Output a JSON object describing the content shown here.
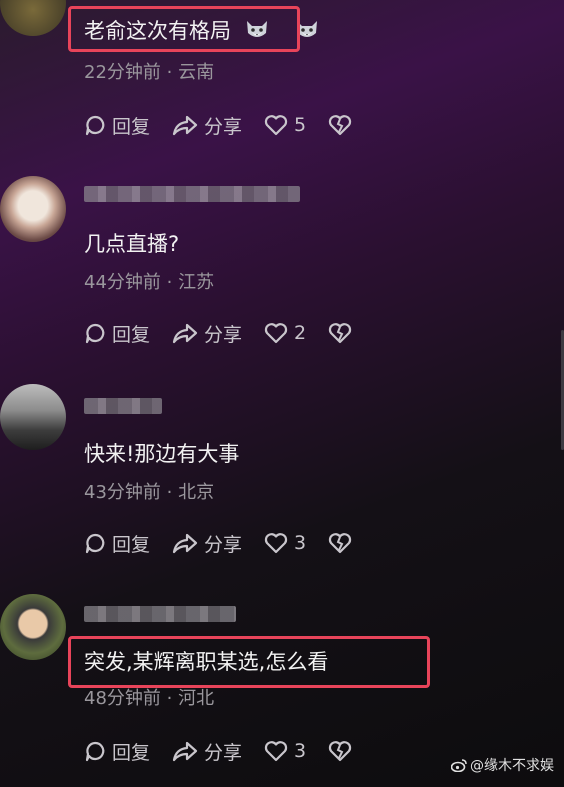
{
  "comments": [
    {
      "content": "老俞这次有格局",
      "meta": "22分钟前 · 云南",
      "reply": "回复",
      "share": "分享",
      "likes": "5"
    },
    {
      "content": "几点直播?",
      "meta": "44分钟前 · 江苏",
      "reply": "回复",
      "share": "分享",
      "likes": "2"
    },
    {
      "content": "快来!那边有大事",
      "meta": "43分钟前 · 北京",
      "reply": "回复",
      "share": "分享",
      "likes": "3"
    },
    {
      "content": "突发,某辉离职某选,怎么看",
      "meta": "48分钟前 · 河北",
      "reply": "回复",
      "share": "分享",
      "likes": "3"
    }
  ],
  "watermark": "@缘木不求娱",
  "colors": {
    "highlight": "#e8445a",
    "meta": "#9a979d",
    "actions": "#c9c6cc"
  },
  "icons": [
    "reply-icon",
    "share-icon",
    "like-icon",
    "dislike-icon",
    "wolf-emoji-icon"
  ]
}
